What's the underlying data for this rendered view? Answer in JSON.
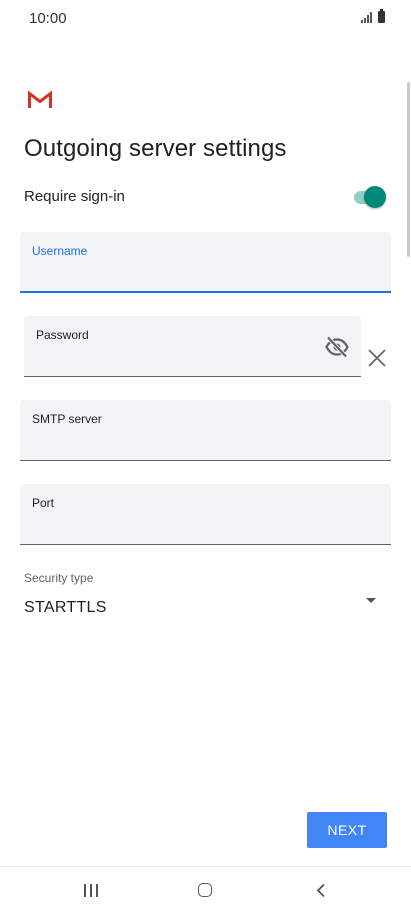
{
  "status_bar": {
    "time": "10:00"
  },
  "page": {
    "title": "Outgoing server settings"
  },
  "require_signin": {
    "label": "Require sign-in",
    "enabled": true
  },
  "fields": {
    "username": {
      "label": "Username",
      "value": ""
    },
    "password": {
      "label": "Password",
      "value": ""
    },
    "smtp_server": {
      "label": "SMTP server",
      "value": ""
    },
    "port": {
      "label": "Port",
      "value": ""
    }
  },
  "security": {
    "label": "Security type",
    "value": "STARTTLS"
  },
  "actions": {
    "next_label": "NEXT"
  },
  "colors": {
    "accent": "#1a73e8",
    "toggle": "#00897b",
    "button": "#4285f4",
    "gmail_red": "#d93025"
  },
  "icons": [
    "gmail-logo",
    "signal-icon",
    "battery-icon",
    "eye-off-icon",
    "close-icon",
    "dropdown-arrow-icon",
    "recents-icon",
    "home-icon",
    "back-icon"
  ]
}
